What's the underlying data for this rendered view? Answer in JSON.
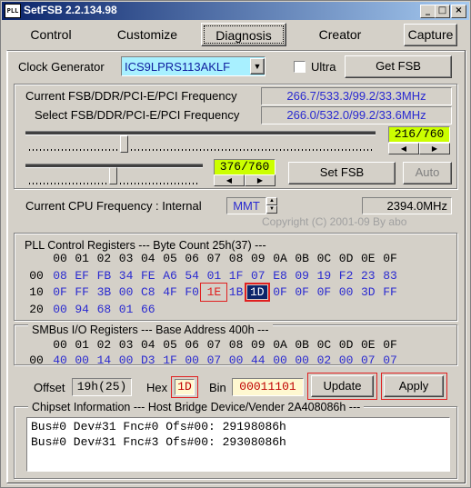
{
  "window": {
    "title": "SetFSB 2.2.134.98",
    "icon_text": "PLL"
  },
  "tabs": [
    {
      "label": "Control"
    },
    {
      "label": "Customize"
    },
    {
      "label": "Diagnosis"
    },
    {
      "label": "Creator"
    }
  ],
  "capture_label": "Capture",
  "clock_generator": {
    "label": "Clock Generator",
    "value": "ICS9LPRS113AKLF",
    "ultra_label": "Ultra",
    "get_fsb_label": "Get FSB"
  },
  "freq": {
    "current_label": "Current FSB/DDR/PCI-E/PCI Frequency",
    "current_value": "266.7/533.3/99.2/33.3MHz",
    "select_label": "Select FSB/DDR/PCI-E/PCI Frequency",
    "select_value": "266.0/532.0/99.2/33.6MHz",
    "slider1_readout": "216/760",
    "slider1_level": 0.28,
    "slider2_readout": "376/760",
    "slider2_level": 0.49,
    "set_fsb_label": "Set FSB",
    "auto_label": "Auto"
  },
  "cpu": {
    "label": "Current CPU Frequency : Internal",
    "mode": "MMT",
    "value": "2394.0MHz",
    "copyright": "Copyright (C) 2001-09 By abo"
  },
  "pll": {
    "title": "PLL Control Registers  --- Byte Count 25h(37) ---",
    "header": [
      "00",
      "01",
      "02",
      "03",
      "04",
      "05",
      "06",
      "07",
      "08",
      "09",
      "0A",
      "0B",
      "0C",
      "0D",
      "0E",
      "0F"
    ],
    "rows": [
      {
        "addr": "00",
        "values": [
          "08",
          "EF",
          "FB",
          "34",
          "FE",
          "A6",
          "54",
          "01",
          "1F",
          "07",
          "E8",
          "09",
          "19",
          "F2",
          "23",
          "83"
        ]
      },
      {
        "addr": "10",
        "values": [
          "0F",
          "FF",
          "3B",
          "00",
          "C8",
          "4F",
          "F0",
          "1E",
          "1B",
          "1D",
          "0F",
          "0F",
          "0F",
          "00",
          "3D",
          "FF"
        ]
      },
      {
        "addr": "20",
        "values": [
          "00",
          "94",
          "68",
          "01",
          "66"
        ]
      }
    ]
  },
  "smbus": {
    "title": "SMBus I/O Registers  --- Base Address 400h ---",
    "header": [
      "00",
      "01",
      "02",
      "03",
      "04",
      "05",
      "06",
      "07",
      "08",
      "09",
      "0A",
      "0B",
      "0C",
      "0D",
      "0E",
      "0F"
    ],
    "rows": [
      {
        "addr": "00",
        "values": [
          "40",
          "00",
          "14",
          "00",
          "D3",
          "1F",
          "00",
          "07",
          "00",
          "44",
          "00",
          "00",
          "02",
          "00",
          "07",
          "07"
        ]
      }
    ]
  },
  "edit": {
    "offset_label": "Offset",
    "offset_value": "19h(25)",
    "hex_label": "Hex",
    "hex_value": "1D",
    "bin_label": "Bin",
    "bin_value": "00011101",
    "update_label": "Update",
    "apply_label": "Apply"
  },
  "chipset": {
    "title": "Chipset Information  --- Host Bridge Device/Vender 2A408086h ---",
    "lines": [
      "Bus#0 Dev#31 Fnc#0 Ofs#00: 29198086h",
      "Bus#0 Dev#31 Fnc#3 Ofs#00: 29308086h"
    ]
  },
  "colors": {
    "titlebar_start": "#0a246a",
    "titlebar_end": "#a6caf0",
    "value_blue": "#2a2ad0",
    "highlight_green": "#ccff00",
    "marker_red": "#e02020",
    "selected_cell": "#0a246a"
  }
}
